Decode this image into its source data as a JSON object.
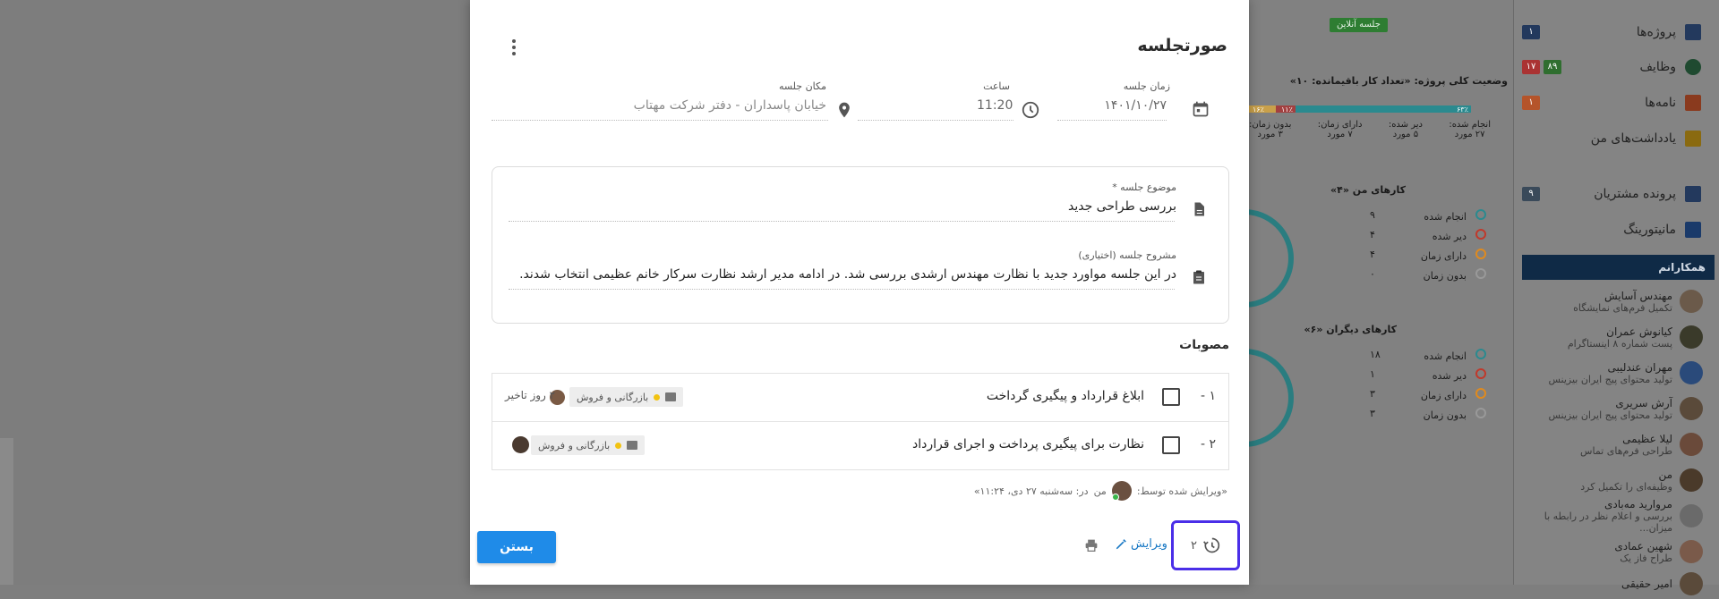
{
  "colors": {
    "accent": "#1f8be8",
    "focus_outline": "#4a2ee8",
    "link": "#1677c4"
  },
  "sidebar": {
    "items": [
      {
        "label": "پروژه‌ها",
        "icon": "projects-icon",
        "badges": [
          {
            "text": "۱",
            "color": "#23395d"
          }
        ]
      },
      {
        "label": "وظایف",
        "icon": "tasks-icon",
        "badges": [
          {
            "text": "۸۹",
            "color": "#2f7a2f"
          },
          {
            "text": "۱۷",
            "color": "#b33"
          }
        ]
      },
      {
        "label": "نامه‌ها",
        "icon": "letters-icon",
        "badges": [
          {
            "text": "۱",
            "color": "#c0582b"
          }
        ]
      },
      {
        "label": "یادداشت‌های من",
        "icon": "notes-icon",
        "badges": []
      },
      {
        "label": "پرونده مشتریان",
        "icon": "customers-icon",
        "badges": [
          {
            "text": "۹",
            "color": "#23395d"
          }
        ]
      },
      {
        "label": "مانیتورینگ",
        "icon": "monitoring-icon",
        "badges": []
      }
    ],
    "team_title": "همکارانم",
    "members": [
      {
        "name": "مهندس آسایش",
        "role": "تکمیل فرم‌های نمایشگاه"
      },
      {
        "name": "کیانوش عمران",
        "role": "پست شماره ۸ اینستاگرام"
      },
      {
        "name": "مهران عندلیبی",
        "role": "تولید محتوای پیج ایران بیزینس"
      },
      {
        "name": "آرش سریری",
        "role": "تولید محتوای پیج ایران بیزینس"
      },
      {
        "name": "لیلا عظیمی",
        "role": "طراحی فرم‌های تماس"
      },
      {
        "name": "من",
        "role": "وظیفه‌ای را تکمیل کرد"
      },
      {
        "name": "مروارید مه‌بادی",
        "role": "بررسی و اعلام نظر در رابطه با میزان..."
      },
      {
        "name": "شهین عمادی",
        "role": "طراح فاز یک"
      },
      {
        "name": "امیر حقیقی",
        "role": ""
      }
    ]
  },
  "dashboard": {
    "online_badge": "جلسه آنلاین",
    "project_status_title": "وضعیت کلی پروژه: «تعداد کار باقیمانده: ۱۰»",
    "bar_labels": [
      "۶۳٪",
      "۱۱٪",
      "۱۶٪"
    ],
    "status_cols": [
      {
        "label": "انجام شده:",
        "value": "۲۷ مورد"
      },
      {
        "label": "دیر شده:",
        "value": "۵ مورد"
      },
      {
        "label": "دارای زمان:",
        "value": "۷ مورد"
      },
      {
        "label": "بدون زمان:",
        "value": "۳ مورد"
      }
    ],
    "my_tasks_title": "کارهای من «۴»",
    "my_tasks": [
      {
        "label": "انجام شده",
        "value": "۹",
        "color": "#2a8a8f"
      },
      {
        "label": "دیر شده",
        "value": "۴",
        "color": "#c0392b"
      },
      {
        "label": "دارای زمان",
        "value": "۴",
        "color": "#e08a1e"
      },
      {
        "label": "بدون زمان",
        "value": "۰",
        "color": "#999"
      }
    ],
    "others_tasks_title": "کارهای دیگران «۶»",
    "others_tasks": [
      {
        "label": "انجام شده",
        "value": "۱۸",
        "color": "#2a8a8f"
      },
      {
        "label": "دیر شده",
        "value": "۱",
        "color": "#c0392b"
      },
      {
        "label": "دارای زمان",
        "value": "۳",
        "color": "#e08a1e"
      },
      {
        "label": "بدون زمان",
        "value": "۳",
        "color": "#999"
      }
    ]
  },
  "modal": {
    "title": "صورتجلسه",
    "date_label": "زمان جلسه",
    "date_value": "۱۴۰۱/۱۰/۲۷",
    "time_label": "ساعت",
    "time_value": "11:20",
    "place_label": "مکان جلسه",
    "place_value": "خیابان پاسداران - دفتر شرکت مهتاب",
    "subject_label": "موضوع جلسه *",
    "subject_value": "بررسی طراحی جدید",
    "desc_label": "مشروح جلسه (اختیاری)",
    "desc_value": "در این جلسه مواورد جدید با نظارت مهندس ارشدی بررسی شد. در ادامه مدیر ارشد نظارت سرکار خانم عظیمی انتخاب شدند.",
    "approvals_title": "مصوبات",
    "approvals": [
      {
        "num": "۱ -",
        "text": "ابلاغ قرارداد و پیگیری گرداخت",
        "tag": "بازرگانی و فروش",
        "delay": "۲ روز تاخیر"
      },
      {
        "num": "۲ -",
        "text": "نظارت برای پیگیری پرداخت و اجرای قرارداد",
        "tag": "بازرگانی و فروش",
        "delay": ""
      }
    ],
    "edited_prefix": "«ویرایش شده توسط:",
    "edited_by": "من",
    "edited_at": "در: سه‌شنبه ۲۷ دی، ۱۱:۲۴»",
    "history_count": "۲",
    "edit_label": "ویرایش",
    "close_label": "بستن"
  }
}
